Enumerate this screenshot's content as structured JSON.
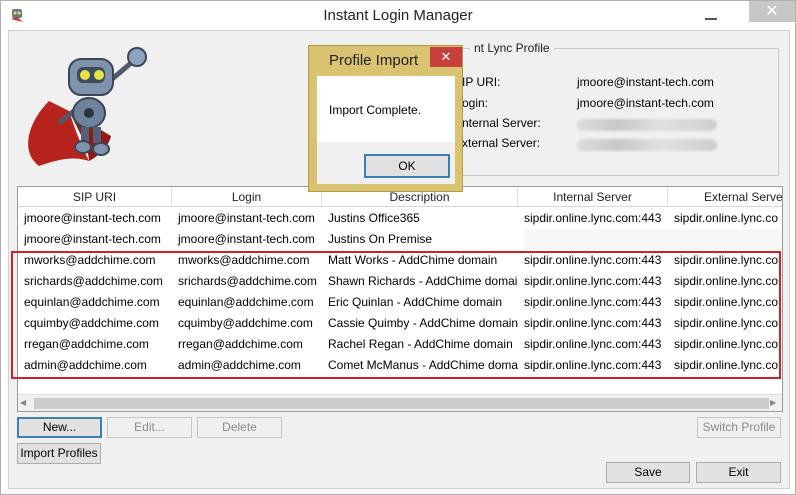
{
  "window": {
    "title": "Instant Login Manager",
    "close_glyph": "✕"
  },
  "profile": {
    "legend": "nt Lync Profile",
    "fields": [
      {
        "label": "IP URI:",
        "value": "jmoore@instant-tech.com"
      },
      {
        "label": "ogin:",
        "value": "jmoore@instant-tech.com"
      },
      {
        "label": "nternal Server:",
        "value": ""
      },
      {
        "label": "xternal Server:",
        "value": ""
      }
    ]
  },
  "grid": {
    "columns": [
      "SIP URI",
      "Login",
      "Description",
      "Internal Server",
      "External Server"
    ],
    "rows": [
      [
        "jmoore@instant-tech.com",
        "jmoore@instant-tech.com",
        "Justins Office365",
        "sipdir.online.lync.com:443",
        "sipdir.online.lync.co"
      ],
      [
        "jmoore@instant-tech.com",
        "jmoore@instant-tech.com",
        "Justins On Premise",
        "",
        ""
      ],
      [
        "mworks@addchime.com",
        "mworks@addchime.com",
        "Matt Works - AddChime domain",
        "sipdir.online.lync.com:443",
        "sipdir.online.lync.co"
      ],
      [
        "srichards@addchime.com",
        "srichards@addchime.com",
        "Shawn Richards - AddChime domai",
        "sipdir.online.lync.com:443",
        "sipdir.online.lync.co"
      ],
      [
        "equinlan@addchime.com",
        "equinlan@addchime.com",
        "Eric Quinlan - AddChime domain",
        "sipdir.online.lync.com:443",
        "sipdir.online.lync.co"
      ],
      [
        "cquimby@addchime.com",
        "cquimby@addchime.com",
        "Cassie Quimby - AddChime domain",
        "sipdir.online.lync.com:443",
        "sipdir.online.lync.co"
      ],
      [
        "rregan@addchime.com",
        "rregan@addchime.com",
        "Rachel Regan - AddChime domain",
        "sipdir.online.lync.com:443",
        "sipdir.online.lync.co"
      ],
      [
        "admin@addchime.com",
        "admin@addchime.com",
        "Comet McManus - AddChime doma",
        "sipdir.online.lync.com:443",
        "sipdir.online.lync.co"
      ]
    ]
  },
  "buttons": {
    "new": "New...",
    "edit": "Edit...",
    "delete": "Delete",
    "switch_profile": "Switch Profile",
    "import_profiles": "Import Profiles",
    "save": "Save",
    "exit": "Exit"
  },
  "dialog": {
    "title": "Profile Import",
    "message": "Import Complete.",
    "ok": "OK",
    "close_glyph": "✕"
  },
  "colors": {
    "highlight_border": "#d0202a",
    "dialog_frame": "#d9c370",
    "dialog_close": "#c8403a"
  }
}
